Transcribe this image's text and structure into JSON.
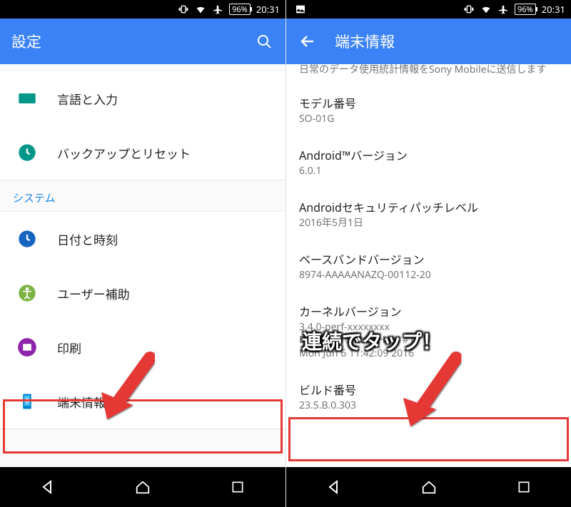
{
  "statusbar": {
    "battery": "96%",
    "time": "20:31"
  },
  "left": {
    "appbar_title": "設定",
    "items": {
      "lang_input": "言語と入力",
      "backup_reset": "バックアップとリセット",
      "section_system": "システム",
      "date_time": "日付と時刻",
      "accessibility": "ユーザー補助",
      "print": "印刷",
      "about": "端末情報"
    }
  },
  "right": {
    "appbar_title": "端末情報",
    "truncated_top": "日常のデータ使用統計情報をSony Mobileに送信します",
    "model_label": "モデル番号",
    "model_value": "SO-01G",
    "android_version_label": "Android™バージョン",
    "android_version_value": "6.0.1",
    "security_label": "Androidセキュリティパッチレベル",
    "security_value": "2016年5月1日",
    "baseband_label": "ベースバンドバージョン",
    "baseband_value": "8974-AAAAANAZQ-00112-20",
    "kernel_label": "カーネルバージョン",
    "kernel_line1": "3.4.0-perf-xxxxxxxx",
    "kernel_line2": "BuildUser@BuildHost #1",
    "kernel_line3": "Mon Jun 6 11:42:09 2016",
    "build_label": "ビルド番号",
    "build_value": "23.5.B.0.303"
  },
  "annotation": {
    "tap_text": "連続でタップ！"
  }
}
